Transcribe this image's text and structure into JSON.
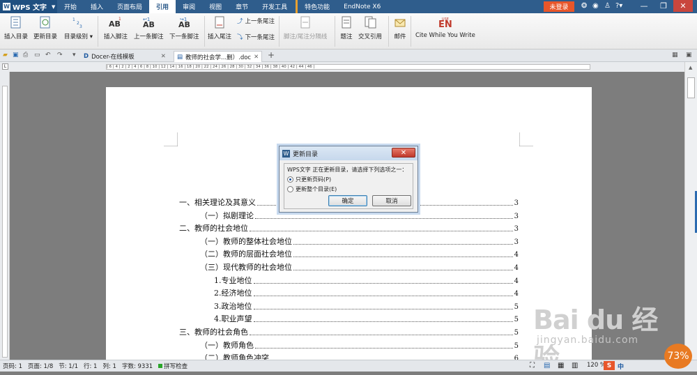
{
  "app": {
    "name": "WPS 文字",
    "logo": "W"
  },
  "menu": [
    "开始",
    "插入",
    "页面布局",
    "引用",
    "审阅",
    "视图",
    "章节",
    "开发工具"
  ],
  "menu_active": "引用",
  "feature_menu": "特色功能",
  "endnote_menu": "EndNote X6",
  "login_label": "未登录",
  "ribbon": {
    "insert_toc": "插入目录",
    "update_toc": "更新目录",
    "toc_level": "目录级别",
    "insert_footnote": "插入脚注",
    "prev_footnote": "上一条脚注",
    "next_footnote": "下一条脚注",
    "insert_endnote": "插入尾注",
    "prev_endnote": "上一条尾注",
    "next_endnote": "下一条尾注",
    "footnote_separator": "脚注/尾注分隔线",
    "caption": "题注",
    "cross_ref": "交叉引用",
    "mail": "邮件",
    "cite_label": "Cite While You Write",
    "en_label": "EN",
    "use_label": "USE"
  },
  "tabs": [
    {
      "label": "Docer-在线模板"
    },
    {
      "label": "教师的社会学...删）.doc"
    }
  ],
  "ruler_text": "| 6 | 4 | 2 | 2 | 4 | 6 | 8 | 10 | 12 | 14 | 16 | 18 | 20 | 22 | 24 | 26 | 28 | 30 | 32 | 34 | 36 | 38 | 40 | 42 | 44 | 46 |",
  "toc": [
    {
      "text": "一、相关理论及其意义",
      "page": "3",
      "indent": 0
    },
    {
      "text": "（一）拟剧理论",
      "page": "3",
      "indent": 1
    },
    {
      "text": "二、教师的社会地位",
      "page": "3",
      "indent": 0
    },
    {
      "text": "（一）教师的整体社会地位",
      "page": "3",
      "indent": 1
    },
    {
      "text": "（二）教师的层面社会地位",
      "page": "4",
      "indent": 1
    },
    {
      "text": "（三）现代教师的社会地位",
      "page": "4",
      "indent": 1
    },
    {
      "text": "1.专业地位",
      "page": "4",
      "indent": 2
    },
    {
      "text": "2.经济地位",
      "page": "4",
      "indent": 2
    },
    {
      "text": "3.政治地位",
      "page": "5",
      "indent": 2
    },
    {
      "text": "4.职业声望",
      "page": "5",
      "indent": 2
    },
    {
      "text": "三、教师的社会角色",
      "page": "5",
      "indent": 0
    },
    {
      "text": "（一）教师角色",
      "page": "5",
      "indent": 1
    },
    {
      "text": "（二）教师角色冲突",
      "page": "6",
      "indent": 1
    }
  ],
  "dialog": {
    "title": "更新目录",
    "message": "WPS文字 正在更新目录，请选择下列选项之一：",
    "option1": "只更新页码(P)",
    "option2": "更新整个目录(E)",
    "ok": "确定",
    "cancel": "取消",
    "close": "✕",
    "selected": "option1"
  },
  "status": {
    "page_num": "页码: 1",
    "pages": "页面: 1/8",
    "section": "节: 1/1",
    "row": "行: 1",
    "col": "列: 1",
    "words": "字数: 9331",
    "spell": "拼写检查",
    "zoom": "120 %"
  },
  "watermark": {
    "logo": "Bai du 经验",
    "url": "jingyan.baidu.com"
  },
  "badge_percent": "73%",
  "colors": {
    "title_bar": "#2f5d8c",
    "login": "#e8562a",
    "accent": "#e87a22"
  }
}
